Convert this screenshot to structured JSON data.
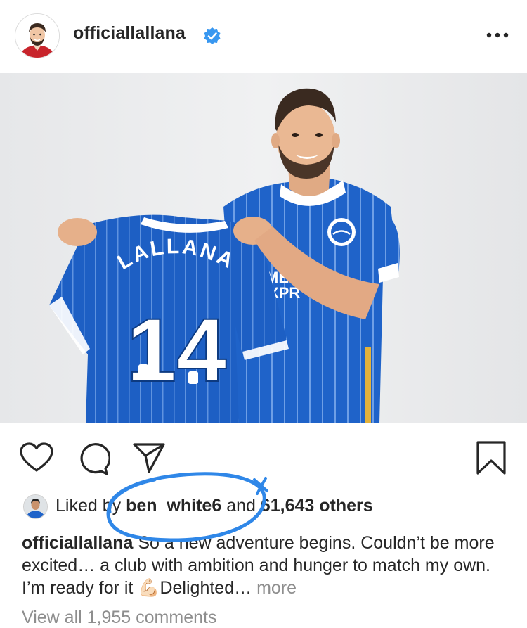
{
  "post": {
    "username": "officiallallana",
    "verified": true,
    "photo": {
      "shirt_name": "LALLANA",
      "shirt_number": "14",
      "sponsor_partial": "ME",
      "sponsor_partial_2": "XPR"
    },
    "likes": {
      "prefix": "Liked by",
      "liker": "ben_white6",
      "connector": "and",
      "others": "61,643 others"
    },
    "caption": {
      "author": "officiallallana",
      "text_1": "So a new adventure begins. Couldn’t be more excited… a club with ambition and hunger to match my own. I’m ready for it",
      "emoji": "💪🏻",
      "text_2": "Delighted…",
      "more": "more"
    },
    "comments": {
      "view_all": "View all 1,955 comments"
    }
  },
  "colors": {
    "verified_blue": "#3897f0",
    "marker_blue": "#2f87e8",
    "text": "#262626",
    "secondary_text": "#8e8e8e",
    "kit_blue": "#1f63c9"
  },
  "icons": [
    "verified-badge-icon",
    "more-options-icon",
    "heart-icon",
    "comment-icon",
    "share-icon",
    "save-bookmark-icon"
  ]
}
